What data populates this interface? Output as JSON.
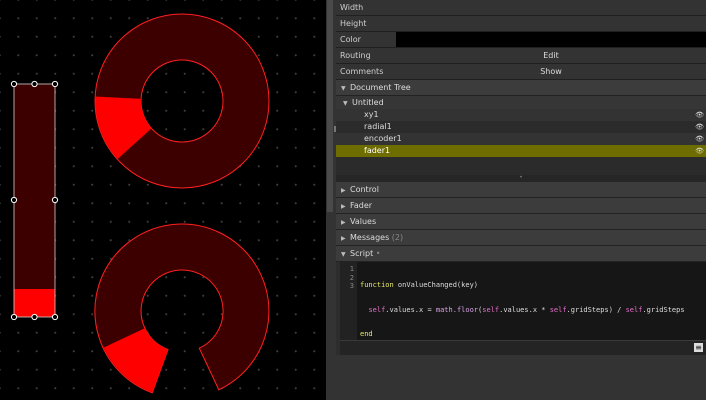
{
  "properties": [
    {
      "label": "Width",
      "value": ""
    },
    {
      "label": "Height",
      "value": ""
    },
    {
      "label": "Color",
      "value": ""
    },
    {
      "label": "Routing",
      "value": "Edit"
    },
    {
      "label": "Comments",
      "value": "Show"
    }
  ],
  "document_tree": {
    "title": "Document Tree",
    "root": "Untitled",
    "items": [
      {
        "label": "xy1",
        "icon": "eye-icon"
      },
      {
        "label": "radial1",
        "icon": "eye-icon"
      },
      {
        "label": "encoder1",
        "icon": "eye-icon"
      },
      {
        "label": "fader1",
        "icon": "eye-icon"
      }
    ],
    "selected": "fader1"
  },
  "sections": {
    "control": "Control",
    "fader": "Fader",
    "values": "Values",
    "messages": "Messages",
    "messages_count": "(2)",
    "script": "Script",
    "script_suffix": "•"
  },
  "script": {
    "line_numbers": [
      "1",
      "2",
      "3"
    ],
    "line1": {
      "kw": "function",
      "rest": " onValueChanged(key)"
    },
    "line2": {
      "indent": "  ",
      "self1": "self",
      "mid1": ".values.x = ",
      "fn": "math.floor",
      "mid2": "(",
      "self2": "self",
      "mid3": ".values.x * ",
      "self3": "self",
      "mid4": ".gridSteps) / ",
      "self4": "self",
      "end": ".gridSteps"
    },
    "line3": {
      "kw": "end"
    }
  },
  "canvas": {
    "fader_level": 0.12,
    "radial_top_fill_deg": 45,
    "radial_bottom_fill_deg": 45,
    "colors": {
      "fill": "#ff0000",
      "track": "#3d0000",
      "outline": "#ff2020",
      "background": "#000000"
    }
  },
  "colors": {
    "selected_row": "#6d6d00",
    "panel_bg": "#2d2d2d"
  }
}
